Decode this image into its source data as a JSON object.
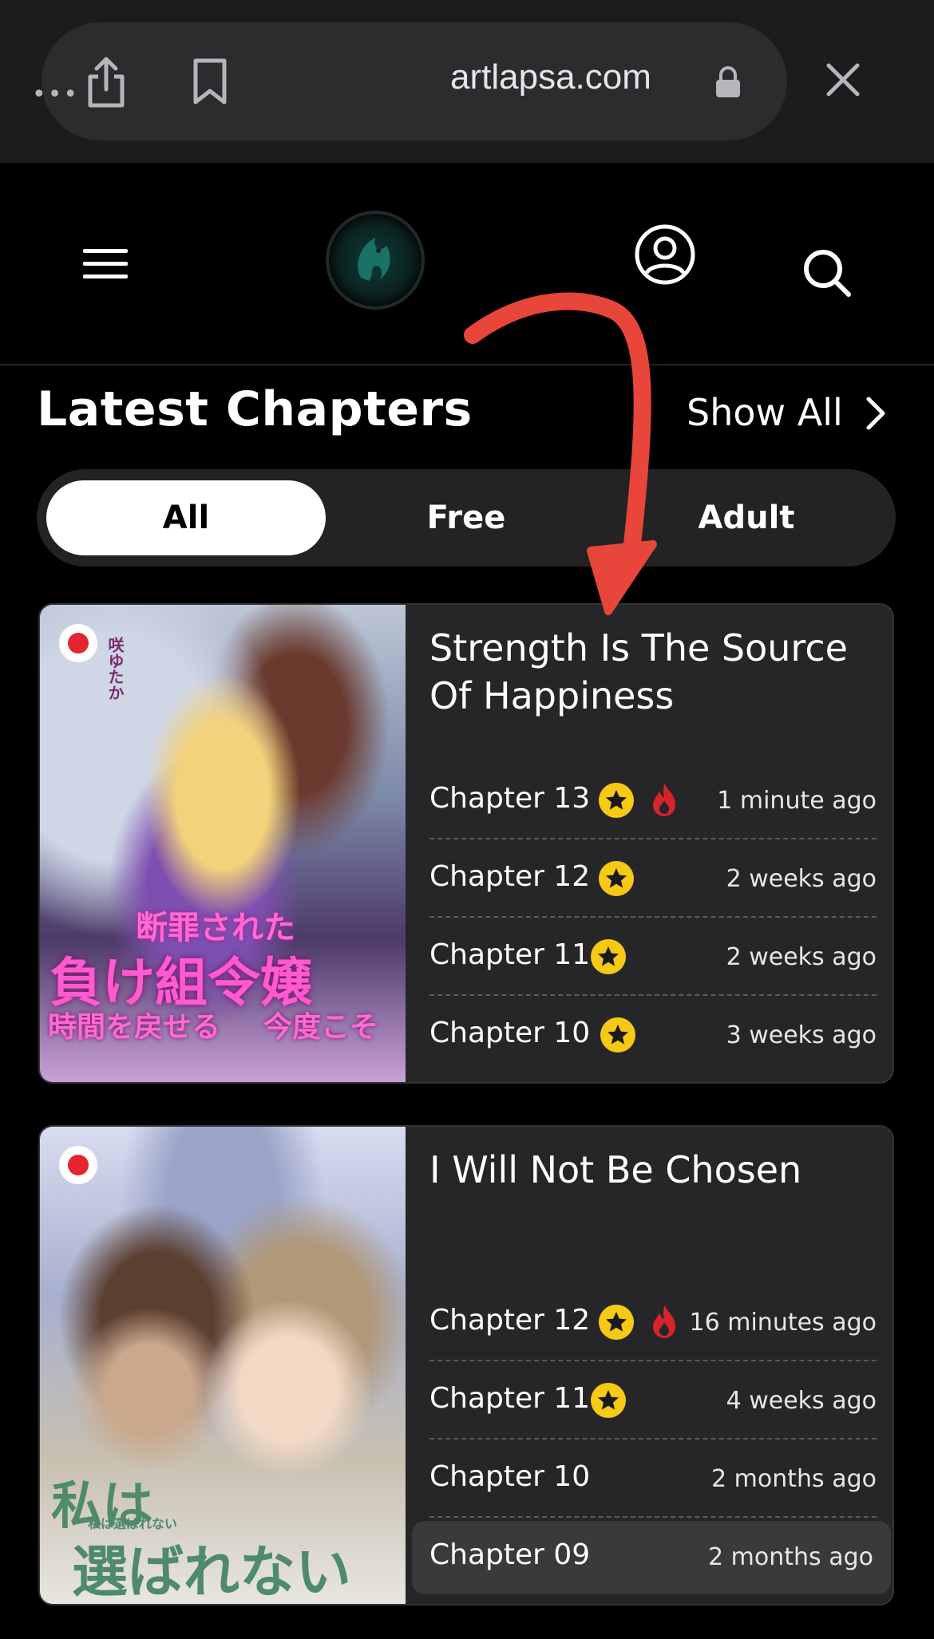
{
  "browser": {
    "url": "artlapsa.com"
  },
  "header": {
    "logo_name": "site-logo"
  },
  "section": {
    "title": "Latest Chapters",
    "show_all": "Show All"
  },
  "tabs": [
    {
      "label": "All",
      "active": true
    },
    {
      "label": "Free",
      "active": false
    },
    {
      "label": "Adult",
      "active": false
    }
  ],
  "series": [
    {
      "title": "Strength Is The Source Of Happiness",
      "cover_text": [
        "断罪された",
        "負け組令嬢",
        "時間を戻せる",
        "今度こそ",
        "咲ゆたか"
      ],
      "chapters": [
        {
          "label": "Chapter 13",
          "premium": true,
          "hot": true,
          "time": "1 minute ago"
        },
        {
          "label": "Chapter 12",
          "premium": true,
          "hot": false,
          "time": "2 weeks ago"
        },
        {
          "label": "Chapter 11",
          "premium": true,
          "hot": false,
          "time": "2 weeks ago"
        },
        {
          "label": "Chapter 10",
          "premium": true,
          "hot": false,
          "time": "3 weeks ago"
        }
      ]
    },
    {
      "title": "I Will Not Be Chosen",
      "cover_text": [
        "私は",
        "選ばれない",
        "私は選ばれない"
      ],
      "chapters": [
        {
          "label": "Chapter 12",
          "premium": true,
          "hot": true,
          "time": "16 minutes ago"
        },
        {
          "label": "Chapter 11",
          "premium": true,
          "hot": false,
          "time": "4 weeks ago"
        },
        {
          "label": "Chapter 10",
          "premium": false,
          "hot": false,
          "time": "2 months ago"
        },
        {
          "label": "Chapter 09",
          "premium": false,
          "hot": false,
          "time": "2 months ago"
        }
      ]
    }
  ],
  "colors": {
    "accent_star": "#f6c915",
    "hot_red": "#e5242e",
    "annotation_arrow": "#e8463a"
  }
}
